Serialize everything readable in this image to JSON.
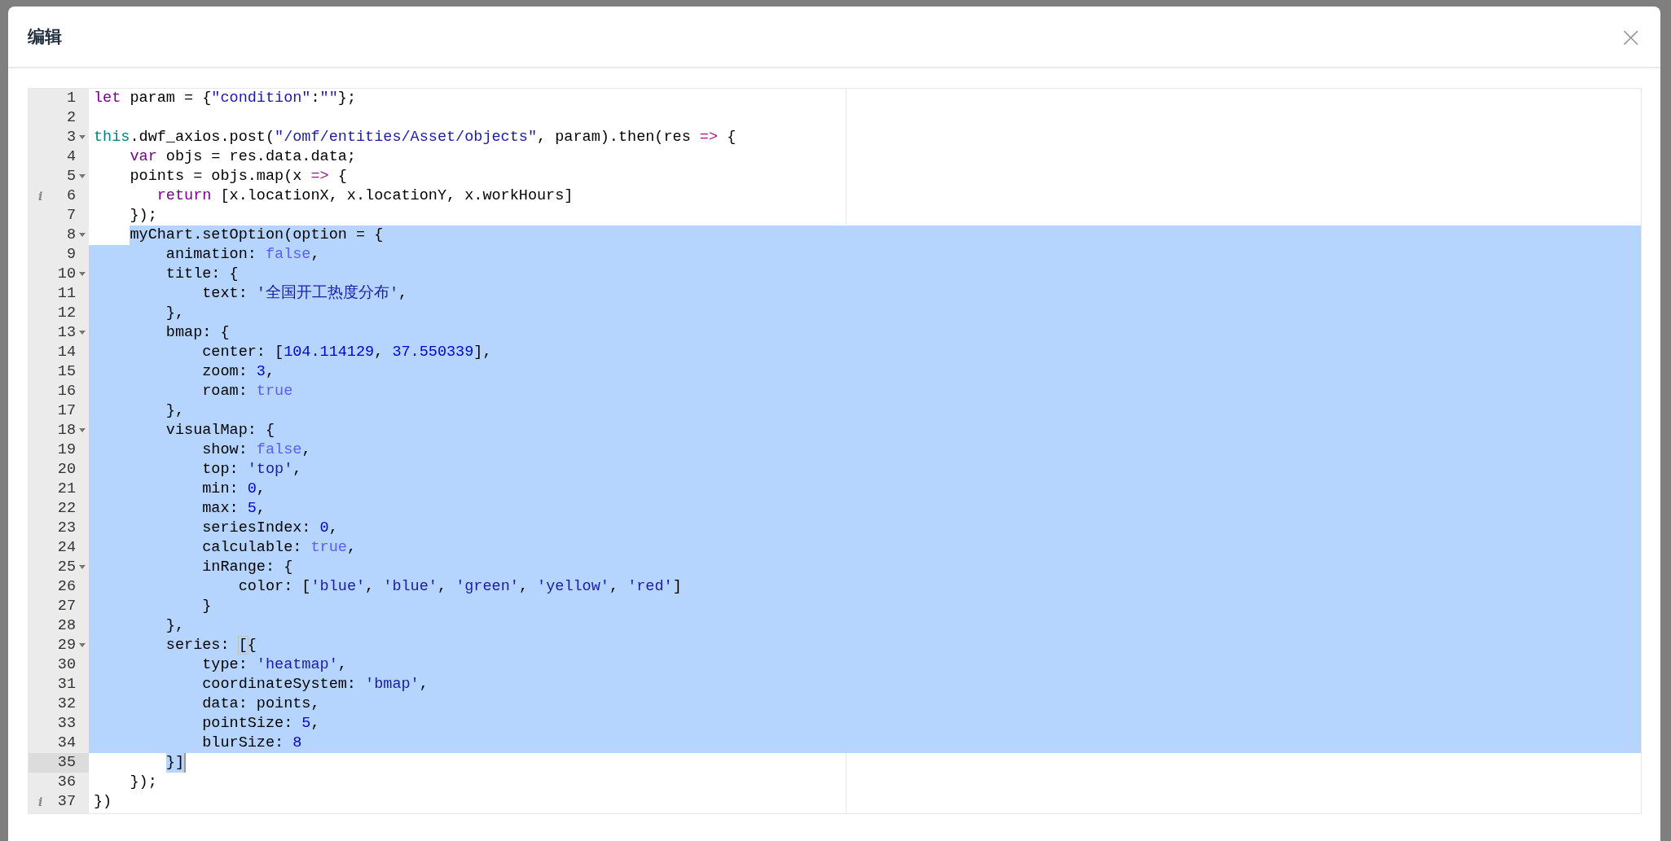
{
  "dialog": {
    "title": "编辑",
    "close_icon": "×"
  },
  "editor": {
    "lines": [
      {
        "number": "1",
        "tokens": [
          {
            "kind": "kw",
            "text": "let"
          },
          {
            "kind": "p",
            "text": " param = {"
          },
          {
            "kind": "s",
            "text": "\"condition\""
          },
          {
            "kind": "p",
            "text": ":"
          },
          {
            "kind": "s",
            "text": "\"\""
          },
          {
            "kind": "p",
            "text": "};"
          }
        ]
      },
      {
        "number": "2"
      },
      {
        "number": "3",
        "fold": true,
        "tokens": [
          {
            "kind": "th",
            "text": "this"
          },
          {
            "kind": "p",
            "text": ".dwf_axios.post("
          },
          {
            "kind": "s",
            "text": "\"/omf/entities/Asset/objects\""
          },
          {
            "kind": "p",
            "text": ", param).then(res "
          },
          {
            "kind": "op",
            "text": "=>"
          },
          {
            "kind": "p",
            "text": " {"
          }
        ]
      },
      {
        "number": "4",
        "tokens": [
          {
            "kind": "kw",
            "text": "    var"
          },
          {
            "kind": "p",
            "text": " objs = res.data.data;"
          }
        ]
      },
      {
        "number": "5",
        "fold": true,
        "tokens": [
          {
            "kind": "p",
            "text": "    points = objs.map(x "
          },
          {
            "kind": "op",
            "text": "=>"
          },
          {
            "kind": "p",
            "text": " {"
          }
        ]
      },
      {
        "number": "6",
        "info": "i",
        "tokens": [
          {
            "kind": "kw",
            "text": "       return"
          },
          {
            "kind": "p",
            "text": " [x.locationX, x.locationY, x.workHours]"
          }
        ]
      },
      {
        "number": "7",
        "tokens": [
          {
            "kind": "p",
            "text": "    });"
          }
        ]
      },
      {
        "number": "8",
        "fold": true,
        "selected": true,
        "selection_starts_at_text": true,
        "tokens": [
          {
            "kind": "p",
            "text": "    myChart.setOption(option = {"
          }
        ]
      },
      {
        "number": "9",
        "selected": true,
        "tokens": [
          {
            "kind": "p",
            "text": "        animation: "
          },
          {
            "kind": "a",
            "text": "false"
          },
          {
            "kind": "p",
            "text": ","
          }
        ]
      },
      {
        "number": "10",
        "fold": true,
        "selected": true,
        "tokens": [
          {
            "kind": "p",
            "text": "        title: {"
          }
        ]
      },
      {
        "number": "11",
        "selected": true,
        "tokens": [
          {
            "kind": "p",
            "text": "            text: "
          },
          {
            "kind": "s",
            "text": "'全国开工热度分布'"
          },
          {
            "kind": "p",
            "text": ","
          }
        ]
      },
      {
        "number": "12",
        "selected": true,
        "tokens": [
          {
            "kind": "p",
            "text": "        },"
          }
        ]
      },
      {
        "number": "13",
        "fold": true,
        "selected": true,
        "tokens": [
          {
            "kind": "p",
            "text": "        bmap: {"
          }
        ]
      },
      {
        "number": "14",
        "selected": true,
        "tokens": [
          {
            "kind": "p",
            "text": "            center: ["
          },
          {
            "kind": "n",
            "text": "104.114129"
          },
          {
            "kind": "p",
            "text": ", "
          },
          {
            "kind": "n",
            "text": "37.550339"
          },
          {
            "kind": "p",
            "text": "],"
          }
        ]
      },
      {
        "number": "15",
        "selected": true,
        "tokens": [
          {
            "kind": "p",
            "text": "            zoom: "
          },
          {
            "kind": "n",
            "text": "3"
          },
          {
            "kind": "p",
            "text": ","
          }
        ]
      },
      {
        "number": "16",
        "selected": true,
        "tokens": [
          {
            "kind": "p",
            "text": "            roam: "
          },
          {
            "kind": "a",
            "text": "true"
          }
        ]
      },
      {
        "number": "17",
        "selected": true,
        "tokens": [
          {
            "kind": "p",
            "text": "        },"
          }
        ]
      },
      {
        "number": "18",
        "fold": true,
        "selected": true,
        "tokens": [
          {
            "kind": "p",
            "text": "        visualMap: {"
          }
        ]
      },
      {
        "number": "19",
        "selected": true,
        "tokens": [
          {
            "kind": "p",
            "text": "            show: "
          },
          {
            "kind": "a",
            "text": "false"
          },
          {
            "kind": "p",
            "text": ","
          }
        ]
      },
      {
        "number": "20",
        "selected": true,
        "tokens": [
          {
            "kind": "p",
            "text": "            top: "
          },
          {
            "kind": "s",
            "text": "'top'"
          },
          {
            "kind": "p",
            "text": ","
          }
        ]
      },
      {
        "number": "21",
        "selected": true,
        "tokens": [
          {
            "kind": "p",
            "text": "            min: "
          },
          {
            "kind": "n",
            "text": "0"
          },
          {
            "kind": "p",
            "text": ","
          }
        ]
      },
      {
        "number": "22",
        "selected": true,
        "tokens": [
          {
            "kind": "p",
            "text": "            max: "
          },
          {
            "kind": "n",
            "text": "5"
          },
          {
            "kind": "p",
            "text": ","
          }
        ]
      },
      {
        "number": "23",
        "selected": true,
        "tokens": [
          {
            "kind": "p",
            "text": "            seriesIndex: "
          },
          {
            "kind": "n",
            "text": "0"
          },
          {
            "kind": "p",
            "text": ","
          }
        ]
      },
      {
        "number": "24",
        "selected": true,
        "tokens": [
          {
            "kind": "p",
            "text": "            calculable: "
          },
          {
            "kind": "a",
            "text": "true"
          },
          {
            "kind": "p",
            "text": ","
          }
        ]
      },
      {
        "number": "25",
        "fold": true,
        "selected": true,
        "tokens": [
          {
            "kind": "p",
            "text": "            inRange: {"
          }
        ]
      },
      {
        "number": "26",
        "selected": true,
        "tokens": [
          {
            "kind": "p",
            "text": "                color: ["
          },
          {
            "kind": "s",
            "text": "'blue'"
          },
          {
            "kind": "p",
            "text": ", "
          },
          {
            "kind": "s",
            "text": "'blue'"
          },
          {
            "kind": "p",
            "text": ", "
          },
          {
            "kind": "s",
            "text": "'green'"
          },
          {
            "kind": "p",
            "text": ", "
          },
          {
            "kind": "s",
            "text": "'yellow'"
          },
          {
            "kind": "p",
            "text": ", "
          },
          {
            "kind": "s",
            "text": "'red'"
          },
          {
            "kind": "p",
            "text": "]"
          }
        ]
      },
      {
        "number": "27",
        "selected": true,
        "tokens": [
          {
            "kind": "p",
            "text": "            }"
          }
        ]
      },
      {
        "number": "28",
        "selected": true,
        "tokens": [
          {
            "kind": "p",
            "text": "        },"
          }
        ]
      },
      {
        "number": "29",
        "fold": true,
        "selected": true,
        "tokens": [
          {
            "kind": "p",
            "text": "        series: "
          },
          {
            "kind": "br",
            "text": "["
          },
          {
            "kind": "p",
            "text": "{"
          }
        ]
      },
      {
        "number": "30",
        "selected": true,
        "tokens": [
          {
            "kind": "p",
            "text": "            type: "
          },
          {
            "kind": "s",
            "text": "'heatmap'"
          },
          {
            "kind": "p",
            "text": ","
          }
        ]
      },
      {
        "number": "31",
        "selected": true,
        "tokens": [
          {
            "kind": "p",
            "text": "            coordinateSystem: "
          },
          {
            "kind": "s",
            "text": "'bmap'"
          },
          {
            "kind": "p",
            "text": ","
          }
        ]
      },
      {
        "number": "32",
        "selected": true,
        "tokens": [
          {
            "kind": "p",
            "text": "            data: points,"
          }
        ]
      },
      {
        "number": "33",
        "selected": true,
        "tokens": [
          {
            "kind": "p",
            "text": "            pointSize: "
          },
          {
            "kind": "n",
            "text": "5"
          },
          {
            "kind": "p",
            "text": ","
          }
        ]
      },
      {
        "number": "34",
        "selected": true,
        "tokens": [
          {
            "kind": "p",
            "text": "            blurSize: "
          },
          {
            "kind": "n",
            "text": "8"
          }
        ]
      },
      {
        "number": "35",
        "active": true,
        "selected": true,
        "selection_ends_at_text": true,
        "tokens": [
          {
            "kind": "p",
            "text": "        }]"
          }
        ]
      },
      {
        "number": "36",
        "tokens": [
          {
            "kind": "p",
            "text": "    });"
          }
        ]
      },
      {
        "number": "37",
        "info": "i",
        "tokens": [
          {
            "kind": "p",
            "text": "})"
          }
        ]
      }
    ]
  }
}
